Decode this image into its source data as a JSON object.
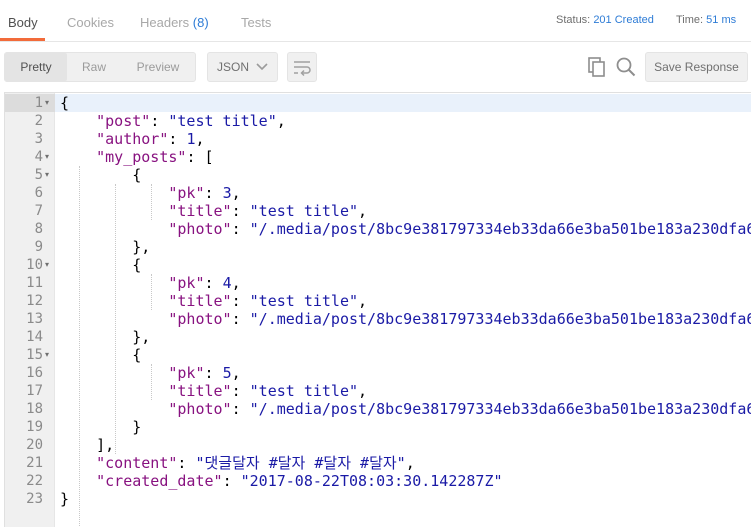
{
  "tabs": [
    {
      "label": "Body",
      "active": true
    },
    {
      "label": "Cookies",
      "active": false
    },
    {
      "label": "Headers",
      "count": "(8)",
      "active": false
    },
    {
      "label": "Tests",
      "active": false
    }
  ],
  "status": {
    "label": "Status:",
    "value": "201 Created"
  },
  "time": {
    "label": "Time:",
    "value": "51 ms"
  },
  "view_modes": [
    {
      "label": "Pretty",
      "active": true
    },
    {
      "label": "Raw",
      "active": false
    },
    {
      "label": "Preview",
      "active": false
    }
  ],
  "format": {
    "selected": "JSON"
  },
  "save_label": "Save Response",
  "icons": {
    "wrap": "wrap-lines-icon",
    "copy": "copy-icon",
    "search": "search-icon",
    "fold": "fold-arrow-icon"
  },
  "colors": {
    "accent": "#f26b3a",
    "link": "#2e7cd6",
    "key": "#881280",
    "string": "#1a1aa6"
  },
  "code_lines": [
    {
      "num": "1",
      "fold": true,
      "tokens": [
        {
          "t": "{",
          "c": "p"
        }
      ]
    },
    {
      "num": "2",
      "fold": false,
      "tokens": [
        {
          "t": "    ",
          "c": "p"
        },
        {
          "t": "\"post\"",
          "c": "k"
        },
        {
          "t": ": ",
          "c": "p"
        },
        {
          "t": "\"test title\"",
          "c": "s"
        },
        {
          "t": ",",
          "c": "p"
        }
      ]
    },
    {
      "num": "3",
      "fold": false,
      "tokens": [
        {
          "t": "    ",
          "c": "p"
        },
        {
          "t": "\"author\"",
          "c": "k"
        },
        {
          "t": ": ",
          "c": "p"
        },
        {
          "t": "1",
          "c": "n"
        },
        {
          "t": ",",
          "c": "p"
        }
      ]
    },
    {
      "num": "4",
      "fold": true,
      "tokens": [
        {
          "t": "    ",
          "c": "p"
        },
        {
          "t": "\"my_posts\"",
          "c": "k"
        },
        {
          "t": ": [",
          "c": "p"
        }
      ]
    },
    {
      "num": "5",
      "fold": true,
      "tokens": [
        {
          "t": "        {",
          "c": "p"
        }
      ]
    },
    {
      "num": "6",
      "fold": false,
      "tokens": [
        {
          "t": "            ",
          "c": "p"
        },
        {
          "t": "\"pk\"",
          "c": "k"
        },
        {
          "t": ": ",
          "c": "p"
        },
        {
          "t": "3",
          "c": "n"
        },
        {
          "t": ",",
          "c": "p"
        }
      ]
    },
    {
      "num": "7",
      "fold": false,
      "tokens": [
        {
          "t": "            ",
          "c": "p"
        },
        {
          "t": "\"title\"",
          "c": "k"
        },
        {
          "t": ": ",
          "c": "p"
        },
        {
          "t": "\"test title\"",
          "c": "s"
        },
        {
          "t": ",",
          "c": "p"
        }
      ]
    },
    {
      "num": "8",
      "fold": false,
      "tokens": [
        {
          "t": "            ",
          "c": "p"
        },
        {
          "t": "\"photo\"",
          "c": "k"
        },
        {
          "t": ": ",
          "c": "p"
        },
        {
          "t": "\"/.media/post/8bc9e381797334eb33da66e3ba501be183a230dfa6",
          "c": "s"
        }
      ]
    },
    {
      "num": "9",
      "fold": false,
      "tokens": [
        {
          "t": "        },",
          "c": "p"
        }
      ]
    },
    {
      "num": "10",
      "fold": true,
      "tokens": [
        {
          "t": "        {",
          "c": "p"
        }
      ]
    },
    {
      "num": "11",
      "fold": false,
      "tokens": [
        {
          "t": "            ",
          "c": "p"
        },
        {
          "t": "\"pk\"",
          "c": "k"
        },
        {
          "t": ": ",
          "c": "p"
        },
        {
          "t": "4",
          "c": "n"
        },
        {
          "t": ",",
          "c": "p"
        }
      ]
    },
    {
      "num": "12",
      "fold": false,
      "tokens": [
        {
          "t": "            ",
          "c": "p"
        },
        {
          "t": "\"title\"",
          "c": "k"
        },
        {
          "t": ": ",
          "c": "p"
        },
        {
          "t": "\"test title\"",
          "c": "s"
        },
        {
          "t": ",",
          "c": "p"
        }
      ]
    },
    {
      "num": "13",
      "fold": false,
      "tokens": [
        {
          "t": "            ",
          "c": "p"
        },
        {
          "t": "\"photo\"",
          "c": "k"
        },
        {
          "t": ": ",
          "c": "p"
        },
        {
          "t": "\"/.media/post/8bc9e381797334eb33da66e3ba501be183a230dfa6",
          "c": "s"
        }
      ]
    },
    {
      "num": "14",
      "fold": false,
      "tokens": [
        {
          "t": "        },",
          "c": "p"
        }
      ]
    },
    {
      "num": "15",
      "fold": true,
      "tokens": [
        {
          "t": "        {",
          "c": "p"
        }
      ]
    },
    {
      "num": "16",
      "fold": false,
      "tokens": [
        {
          "t": "            ",
          "c": "p"
        },
        {
          "t": "\"pk\"",
          "c": "k"
        },
        {
          "t": ": ",
          "c": "p"
        },
        {
          "t": "5",
          "c": "n"
        },
        {
          "t": ",",
          "c": "p"
        }
      ]
    },
    {
      "num": "17",
      "fold": false,
      "tokens": [
        {
          "t": "            ",
          "c": "p"
        },
        {
          "t": "\"title\"",
          "c": "k"
        },
        {
          "t": ": ",
          "c": "p"
        },
        {
          "t": "\"test title\"",
          "c": "s"
        },
        {
          "t": ",",
          "c": "p"
        }
      ]
    },
    {
      "num": "18",
      "fold": false,
      "tokens": [
        {
          "t": "            ",
          "c": "p"
        },
        {
          "t": "\"photo\"",
          "c": "k"
        },
        {
          "t": ": ",
          "c": "p"
        },
        {
          "t": "\"/.media/post/8bc9e381797334eb33da66e3ba501be183a230dfa6",
          "c": "s"
        }
      ]
    },
    {
      "num": "19",
      "fold": false,
      "tokens": [
        {
          "t": "        }",
          "c": "p"
        }
      ]
    },
    {
      "num": "20",
      "fold": false,
      "tokens": [
        {
          "t": "    ],",
          "c": "p"
        }
      ]
    },
    {
      "num": "21",
      "fold": false,
      "tokens": [
        {
          "t": "    ",
          "c": "p"
        },
        {
          "t": "\"content\"",
          "c": "k"
        },
        {
          "t": ": ",
          "c": "p"
        },
        {
          "t": "\"댓글달자 #달자 #달자 #달자\"",
          "c": "s"
        },
        {
          "t": ",",
          "c": "p"
        }
      ]
    },
    {
      "num": "22",
      "fold": false,
      "tokens": [
        {
          "t": "    ",
          "c": "p"
        },
        {
          "t": "\"created_date\"",
          "c": "k"
        },
        {
          "t": ": ",
          "c": "p"
        },
        {
          "t": "\"2017-08-22T08:03:30.142287Z\"",
          "c": "s"
        }
      ]
    },
    {
      "num": "23",
      "fold": false,
      "tokens": [
        {
          "t": "}",
          "c": "p"
        }
      ]
    }
  ]
}
